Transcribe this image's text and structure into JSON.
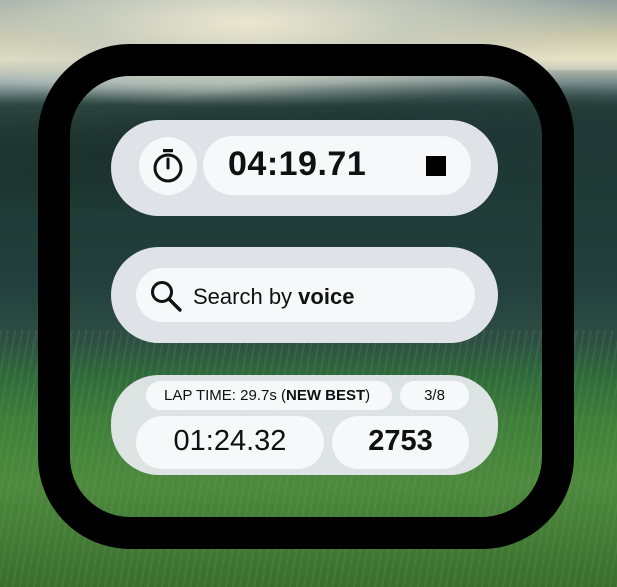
{
  "stopwatch": {
    "icon": "stopwatch-icon",
    "time": "04:19.71",
    "stop_icon": "stop-icon"
  },
  "search": {
    "icon": "search-icon",
    "text_prefix": "Search by ",
    "text_bold": "voice"
  },
  "lap": {
    "label_prefix": "LAP TIME: 29.7s (",
    "label_bold": "NEW BEST",
    "label_suffix": ")",
    "count": "3/8",
    "time": "01:24.32",
    "score": "2753"
  }
}
